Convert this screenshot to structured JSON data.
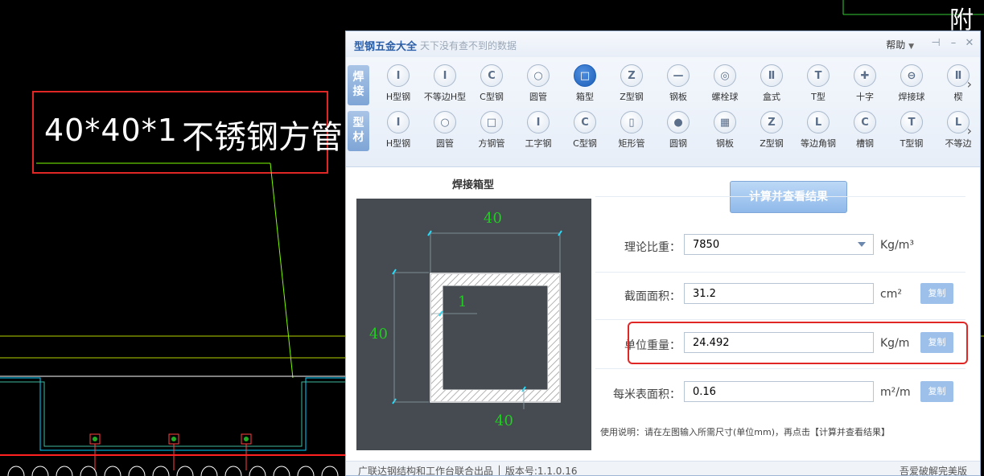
{
  "cad": {
    "label_size": "40*40*1",
    "label_material": "不锈钢方管",
    "right_edge_text": "附"
  },
  "app": {
    "title": "型钢五金大全",
    "slogan": "天下没有查不到的数据",
    "help_label": "帮助",
    "pin_icon": "pin-icon",
    "min_icon": "minimize-icon",
    "close_icon": "close-icon"
  },
  "toolbar": {
    "row1_tag": "焊接",
    "row2_tag": "型材",
    "row1": [
      {
        "label": "H型钢",
        "glyph": "I"
      },
      {
        "label": "不等边H型",
        "glyph": "I"
      },
      {
        "label": "C型钢",
        "glyph": "C"
      },
      {
        "label": "圆管",
        "glyph": "○"
      },
      {
        "label": "箱型",
        "glyph": "□",
        "selected": true
      },
      {
        "label": "Z型钢",
        "glyph": "Z"
      },
      {
        "label": "钢板",
        "glyph": "—"
      },
      {
        "label": "螺栓球",
        "glyph": "◎"
      },
      {
        "label": "盒式",
        "glyph": "Ⅱ"
      },
      {
        "label": "T型",
        "glyph": "T"
      },
      {
        "label": "十字",
        "glyph": "✚"
      },
      {
        "label": "焊接球",
        "glyph": "⊖"
      },
      {
        "label": "楔",
        "glyph": "Ⅱ"
      }
    ],
    "row2": [
      {
        "label": "H型钢",
        "glyph": "I"
      },
      {
        "label": "圆管",
        "glyph": "○"
      },
      {
        "label": "方钢管",
        "glyph": "□"
      },
      {
        "label": "工字钢",
        "glyph": "I"
      },
      {
        "label": "C型钢",
        "glyph": "C"
      },
      {
        "label": "矩形管",
        "glyph": "▯"
      },
      {
        "label": "圆钢",
        "glyph": "●"
      },
      {
        "label": "钢板",
        "glyph": "▦"
      },
      {
        "label": "Z型钢",
        "glyph": "Z"
      },
      {
        "label": "等边角钢",
        "glyph": "L"
      },
      {
        "label": "槽钢",
        "glyph": "C"
      },
      {
        "label": "T型钢",
        "glyph": "T"
      },
      {
        "label": "不等边",
        "glyph": "L"
      }
    ]
  },
  "section": {
    "title": "焊接箱型",
    "dim_top": "40",
    "dim_left": "40",
    "dim_thickness": "1",
    "dim_bottom": "40"
  },
  "calc_button": "计算并查看结果",
  "fields": {
    "density_label": "理论比重：",
    "density_value": "7850",
    "density_unit": "Kg/m³",
    "area_label": "截面面积：",
    "area_value": "31.2",
    "area_unit": "cm²",
    "weight_label": "单位重量：",
    "weight_value": "24.492",
    "weight_unit": "Kg/m",
    "surface_label": "每米表面积：",
    "surface_value": "0.16",
    "surface_unit": "m²/m",
    "copy_label": "复制"
  },
  "usage": "使用说明：请在左图输入所需尺寸(单位mm)，再点击【计算并查看结果】",
  "statusbar": {
    "left": "广联达钢结构和工作台联合出品  │  版本号:1.1.0.16",
    "right": "吾爱破解完美版"
  },
  "colors": {
    "accent": "#2b5ea8",
    "highlight": "#e12626",
    "cad_dim": "#22cc22",
    "cad_cyan": "#00d0ff"
  }
}
